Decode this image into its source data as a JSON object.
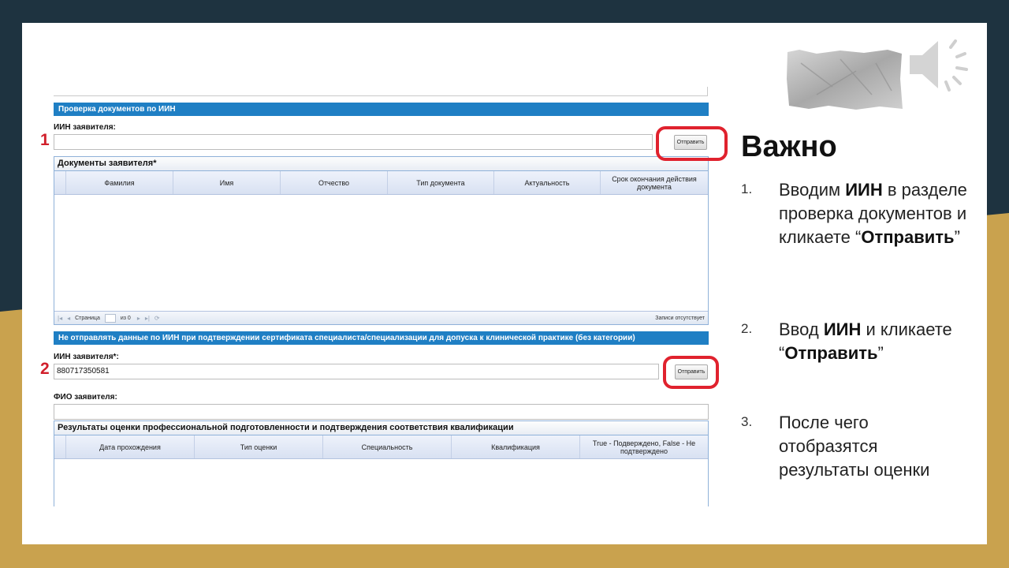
{
  "colors": {
    "accent_blue": "#1f7fc4",
    "highlight_red": "#e0222e",
    "background_dark": "#1e3340",
    "background_gold": "#c9a24e"
  },
  "icons": [
    "tape-icon",
    "speaker-icon"
  ],
  "form": {
    "section1": {
      "header": "Проверка документов по ИИН",
      "iin_label": "ИИН заявителя:",
      "iin_value": "",
      "send_button": "Отправить"
    },
    "documents": {
      "title": "Документы заявителя*",
      "columns": [
        "Фамилия",
        "Имя",
        "Отчество",
        "Тип документа",
        "Актуальность",
        "Срок окончания действия документа"
      ],
      "pager": {
        "page_label": "Страница",
        "page_value": "",
        "of_label": "из 0",
        "status": "Записи отсутствует"
      }
    },
    "section2": {
      "header": "Не отправлять данные по ИИН при подтверждении сертификата специалиста/специализации для допуска к клинической практике (без категории)",
      "iin_label": "ИИН заявителя*:",
      "iin_value": "880717350581",
      "send_button": "Отправить",
      "fio_label": "ФИО заявителя:",
      "fio_value": ""
    },
    "results": {
      "title": "Результаты оценки профессиональной подготовленности и подтверждения соответствия квалификации",
      "columns": [
        "Дата прохождения",
        "Тип оценки",
        "Специальность",
        "Квалификация",
        "True - Подверждено, False - Не подтверждено"
      ]
    }
  },
  "markers": [
    "1",
    "2"
  ],
  "side": {
    "title": "Важно",
    "steps": [
      {
        "n": "1.",
        "pre": "Вводим ",
        "bold": "ИИН",
        "post": " в разделе проверка документов и кликаете ",
        "q_open": "“",
        "bold2": "Отправить",
        "q_close": "”"
      },
      {
        "n": "2.",
        "pre": "Ввод ",
        "bold": "ИИН",
        "post": " и кликаете ",
        "q_open": "“",
        "bold2": "Отправить",
        "q_close": "”"
      },
      {
        "n": "3.",
        "text": "После чего отобразятся результаты оценки"
      }
    ]
  }
}
